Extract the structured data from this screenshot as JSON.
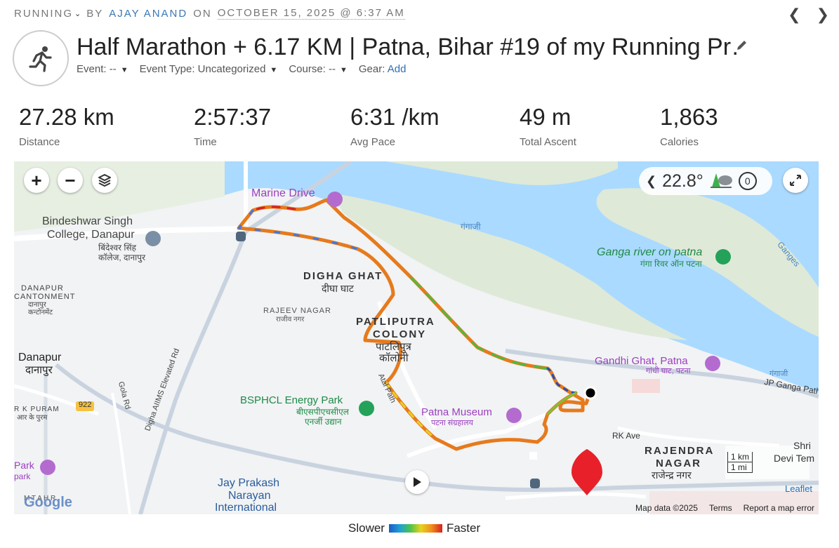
{
  "header": {
    "activity_type": "RUNNING",
    "by": "BY",
    "author": "AJAY ANAND",
    "on": "ON",
    "date": "OCTOBER 15, 2025 @ 6:37 AM",
    "title": "Half Marathon + 6.17 KM | Patna, Bihar #19 of my Running Pr…",
    "meta": {
      "event": "Event: --",
      "event_type": "Event Type: Uncategorized",
      "course": "Course: --",
      "gear_label": "Gear:",
      "gear_add": "Add"
    }
  },
  "stats": [
    {
      "value": "27.28 km",
      "label": "Distance"
    },
    {
      "value": "2:57:37",
      "label": "Time"
    },
    {
      "value": "6:31 /km",
      "label": "Avg Pace"
    },
    {
      "value": "49 m",
      "label": "Total Ascent"
    },
    {
      "value": "1,863",
      "label": "Calories"
    }
  ],
  "map": {
    "weather_temp": "22.8°",
    "weather_count": "0",
    "labels": {
      "marine_drive": "Marine Drive",
      "bindeshwar_1": "Bindeshwar Singh",
      "bindeshwar_2": "College, Danapur",
      "bindeshwar_hi_1": "बिंदेश्वर सिंह",
      "bindeshwar_hi_2": "कॉलेज, दानापुर",
      "ganga_hi": "गंगाजी",
      "ganga_patna": "Ganga river on patna",
      "ganga_patna_hi": "गंगा रिवर ऑन पटना",
      "ganges": "Ganges",
      "digha_ghat": "DIGHA GHAT",
      "digha_ghat_hi": "दीघा घाट",
      "danapur_cant_1": "DANAPUR",
      "danapur_cant_2": "CANTONMENT",
      "danapur_cant_hi_1": "दानापुर",
      "danapur_cant_hi_2": "कन्टोनमेंट",
      "rajeev_nagar": "RAJEEV NAGAR",
      "rajeev_nagar_hi": "राजीव नगर",
      "patliputra_1": "PATLIPUTRA",
      "patliputra_2": "COLONY",
      "patliputra_hi_1": "पाटलिपुत्र",
      "patliputra_hi_2": "कॉलोनी",
      "gandhi_ghat": "Gandhi Ghat, Patna",
      "gandhi_ghat_hi": "गांधी घाट, पटना",
      "gangaji_2": "गंगाजी",
      "jp_ganga": "JP Ganga Path",
      "danapur": "Danapur",
      "danapur_hi": "दानापुर",
      "road_922": "922",
      "gola_rd": "Gola Rd",
      "elevated_rd": "Digha AIIMS Elevated Rd",
      "bsphcl": "BSPHCL Energy Park",
      "bsphcl_hi_1": "बीएसपीएचसीएल",
      "bsphcl_hi_2": "एनर्जी उद्यान",
      "atal_path": "Atal Path",
      "patna_museum": "Patna Museum",
      "patna_museum_hi": "पटना संग्रहालय",
      "rk_ave": "RK Ave",
      "rajendra_1": "RAJENDRA",
      "rajendra_2": "NAGAR",
      "rajendra_hi": "राजेन्द्र नगर",
      "shri": "Shri",
      "devi_tem": "Devi Tem",
      "rk_puram": "R K PURAM",
      "rk_puram_hi": "आर के पुरम",
      "park": "Park",
      "park_hi": "park",
      "jp_1": "Jay Prakash",
      "jp_2": "Narayan",
      "jp_3": "International",
      "mtr": "M  T A  H R",
      "google": "Google"
    },
    "scale_km": "1 km",
    "scale_mi": "1 mi",
    "leaflet": "Leaflet",
    "attribution": {
      "map_data": "Map data ©2025",
      "terms": "Terms",
      "report": "Report a map error"
    }
  },
  "legend": {
    "slower": "Slower",
    "faster": "Faster"
  },
  "colors": {
    "accent_blue": "#3a78b5",
    "water": "#aadaff",
    "sand": "#dfe9d8",
    "route_start": "#000000",
    "route_end": "#e8202a"
  }
}
